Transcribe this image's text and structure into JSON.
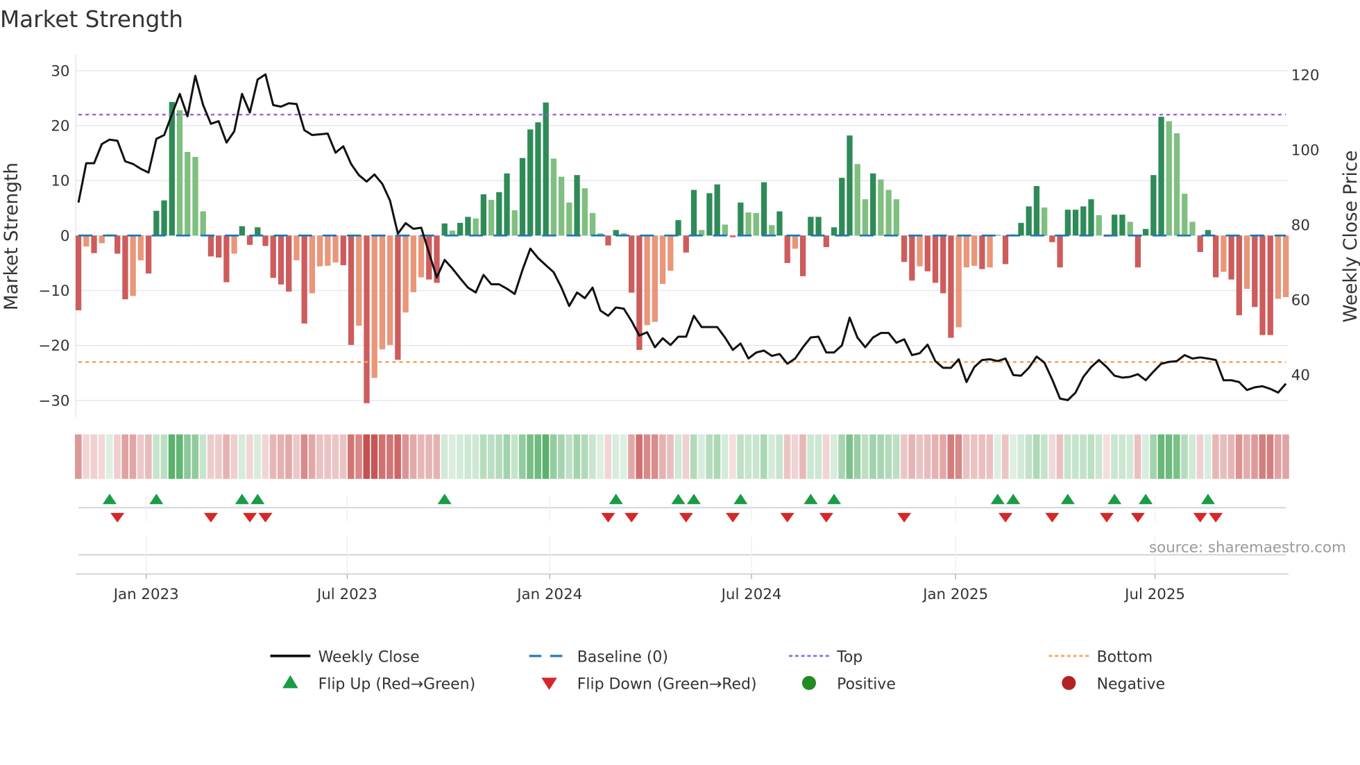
{
  "chart_data": {
    "type": "bar",
    "title": "Market Strength",
    "ylabel": "Market Strength",
    "y2label": "Weekly Close Price",
    "ylim": [
      -33,
      33
    ],
    "y2lim": [
      28.8,
      125.6
    ],
    "yticks": [
      30,
      20,
      10,
      0,
      -10,
      -20,
      -30
    ],
    "ytick_labels": [
      "30",
      "20",
      "10",
      "0",
      "−10",
      "−20",
      "−30"
    ],
    "y2ticks": [
      120,
      100,
      80,
      60,
      40
    ],
    "y2tick_labels": [
      "120",
      "100",
      "80",
      "60",
      "40"
    ],
    "top_level": 22,
    "bottom_level": -23,
    "baseline": 0,
    "x_tick_labels": [
      "Jan 2023",
      "Jul 2023",
      "Jan 2024",
      "Jul 2024",
      "Jan 2025",
      "Jul 2025"
    ],
    "x_tick_weeks": [
      8.7,
      34.5,
      60.5,
      86.4,
      112.6,
      138.2
    ],
    "strength": [
      -13.6,
      -2,
      -3.2,
      -1.4,
      0.2,
      -3.3,
      -11.6,
      -11,
      -4.5,
      -6.9,
      4.5,
      6.4,
      24.3,
      22.8,
      15.2,
      14.3,
      4.4,
      -3.8,
      -4,
      -8.5,
      -3.3,
      1.7,
      -1.7,
      1.5,
      -1.9,
      -7.7,
      -8.9,
      -10.2,
      -4.5,
      -16,
      -10.5,
      -5.6,
      -5.5,
      -4.9,
      -5.4,
      -19.9,
      -16.4,
      -30.5,
      -25.9,
      -20.7,
      -19.9,
      -22.6,
      -14,
      -10.3,
      -7.6,
      -8,
      -8.6,
      2.2,
      0.9,
      2.3,
      3.4,
      3.1,
      7.5,
      6.5,
      7.9,
      11.3,
      4.6,
      14.1,
      19.3,
      20.6,
      24.2,
      14,
      10.7,
      6,
      11,
      8.6,
      4.1,
      0.4,
      -1.8,
      1,
      0.4,
      -10.4,
      -20.8,
      -16.3,
      -15.7,
      -8.8,
      -6.4,
      2.8,
      -3.1,
      8.3,
      1,
      7.7,
      9.3,
      2,
      -0.3,
      6,
      4.2,
      4.1,
      9.7,
      1.9,
      4.4,
      -5,
      -2.4,
      -7.4,
      3.4,
      3.4,
      -2.1,
      1.5,
      10.5,
      18.2,
      13,
      6.6,
      11.3,
      10.2,
      8.3,
      6.6,
      -4.8,
      -8.2,
      -5.6,
      -6.5,
      -8.6,
      -10.5,
      -18.6,
      -16.7,
      -5.8,
      -5.5,
      -6.1,
      -5.8,
      0.1,
      -5.2,
      0.2,
      2.3,
      5.3,
      9,
      5.1,
      -1.2,
      -5.8,
      4.7,
      4.7,
      5.3,
      6.6,
      3.7,
      -0.2,
      3.8,
      3.8,
      2.5,
      -5.8,
      1.2,
      11,
      21.6,
      20.8,
      18.6,
      7.6,
      2.5,
      -3,
      1,
      -7.6,
      -6.6,
      -8,
      -14.5,
      -9.7,
      -13,
      -18.1,
      -18.1,
      -11.5,
      -11.2
    ],
    "weekly_close": [
      86,
      96.5,
      96.5,
      101.6,
      102.8,
      102.5,
      97,
      96.3,
      95,
      94,
      103,
      104,
      109.5,
      115,
      109,
      119.8,
      112,
      107,
      107.7,
      102,
      105,
      115,
      110,
      118.8,
      120.2,
      112,
      111.6,
      112.5,
      112.3,
      105.3,
      104,
      104.2,
      104.4,
      99.3,
      101,
      96.3,
      93.3,
      91.6,
      93.5,
      91,
      86.5,
      77.7,
      80.5,
      79,
      79.3,
      72.6,
      66,
      70.7,
      68.4,
      65.8,
      63.3,
      62,
      66.7,
      64.2,
      64.2,
      63,
      61.6,
      68,
      73.7,
      71.2,
      69.3,
      67.4,
      63.3,
      58.4,
      62,
      60.5,
      63.3,
      57.2,
      55.8,
      58,
      57.7,
      54.4,
      50.5,
      51.4,
      47.4,
      49.8,
      48,
      50.2,
      50.2,
      55.8,
      52.8,
      52.8,
      52.8,
      50,
      46.7,
      48.4,
      44.4,
      46,
      46.5,
      45.1,
      45.6,
      43,
      44.4,
      47.4,
      50,
      50.2,
      46,
      46,
      47.9,
      55.3,
      50,
      47.4,
      50,
      51.2,
      51.2,
      48.6,
      49.5,
      45.3,
      45.8,
      48.1,
      43.7,
      41.9,
      41.9,
      44.2,
      38.1,
      42.1,
      44,
      44.2,
      43.7,
      44.4,
      40,
      39.8,
      41.9,
      44.9,
      43.3,
      38.8,
      33.7,
      33.3,
      35.3,
      39.5,
      42.1,
      44,
      42.1,
      39.8,
      39.3,
      39.5,
      40.2,
      38.6,
      40.9,
      43,
      43.5,
      43.7,
      45.3,
      44.4,
      44.7,
      44.4,
      44,
      38.6,
      38.6,
      38.1,
      36,
      36.7,
      37,
      36.3,
      35.3,
      37.7
    ],
    "legend": {
      "placement": "bottom",
      "items": [
        {
          "key": "close",
          "label": "Weekly Close"
        },
        {
          "key": "baseline",
          "label": "Baseline (0)"
        },
        {
          "key": "top",
          "label": "Top"
        },
        {
          "key": "bottom",
          "label": "Bottom"
        },
        {
          "key": "flip_up",
          "label": "Flip Up (Red→Green)"
        },
        {
          "key": "flip_down",
          "label": "Flip Down (Green→Red)"
        },
        {
          "key": "positive",
          "label": "Positive"
        },
        {
          "key": "negative",
          "label": "Negative"
        }
      ]
    },
    "source": "source: sharemaestro.com"
  },
  "colors": {
    "pos_strong": "#2e8b57",
    "pos_weak": "#7fbf7f",
    "neg_strong": "#cd5c5c",
    "neg_weak": "#e9967a",
    "close": "#111111",
    "baseline": "#1f77b4",
    "top": "#9966dd",
    "bottom": "#f4a460",
    "flip_up": "#1a9c45",
    "flip_down": "#d62728",
    "positive": "#228b22",
    "negative": "#b22222",
    "grid": "#e6e8ee"
  }
}
